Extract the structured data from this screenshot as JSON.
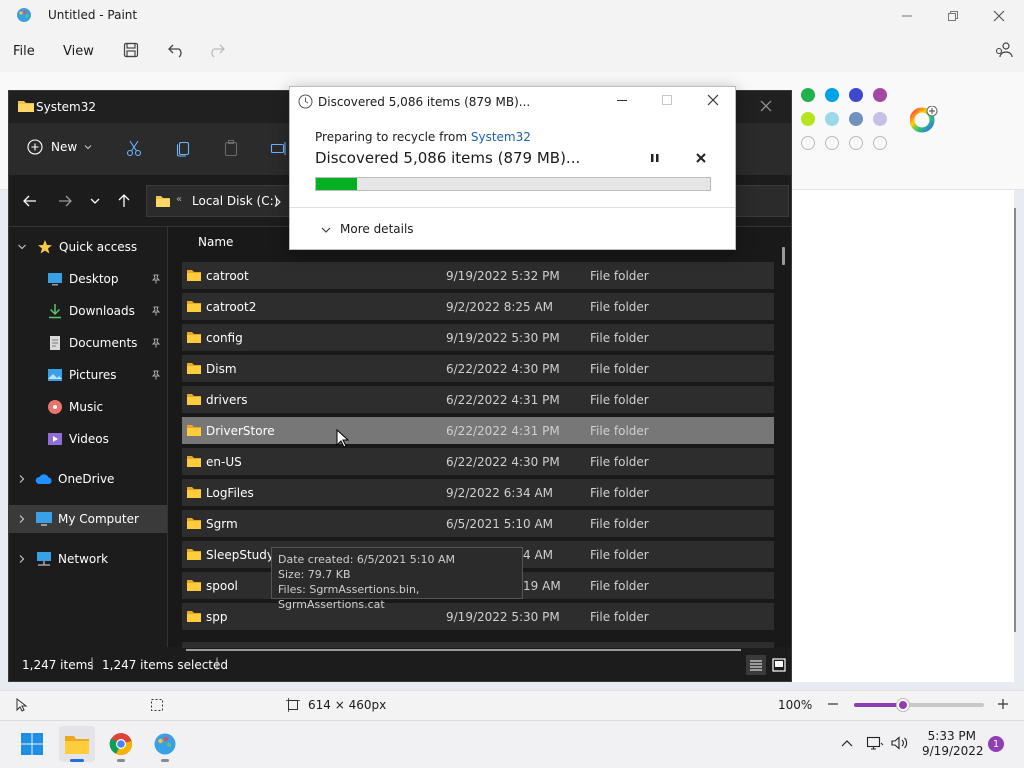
{
  "paint": {
    "title": "Untitled - Paint",
    "menu": [
      "File",
      "View"
    ],
    "status": {
      "canvas_size": "614 × 460px",
      "zoom": "100%"
    },
    "zoom_fraction": 0.38,
    "palette": [
      "#22b14c",
      "#00a2e8",
      "#3f48cc",
      "#a349a4",
      "#b5e61d",
      "#99d9ea",
      "#7092be",
      "#c8bfe7"
    ]
  },
  "explorer": {
    "title": "System32",
    "toolbar": {
      "new_label": "New"
    },
    "breadcrumb": {
      "root": "Local Disk (C:)"
    },
    "column_name": "Name",
    "nav": [
      {
        "label": "Quick access",
        "icon": "star-icon"
      },
      {
        "label": "Desktop",
        "icon": "desktop-icon"
      },
      {
        "label": "Downloads",
        "icon": "download-icon"
      },
      {
        "label": "Documents",
        "icon": "document-icon"
      },
      {
        "label": "Pictures",
        "icon": "picture-icon"
      },
      {
        "label": "Music",
        "icon": "music-icon"
      },
      {
        "label": "Videos",
        "icon": "video-icon"
      },
      {
        "label": "OneDrive",
        "icon": "cloud-icon"
      },
      {
        "label": "My Computer",
        "icon": "computer-icon"
      },
      {
        "label": "Network",
        "icon": "network-icon"
      }
    ],
    "files": [
      {
        "name": "catroot",
        "date": "9/19/2022 5:32 PM",
        "type": "File folder"
      },
      {
        "name": "catroot2",
        "date": "9/2/2022 8:25 AM",
        "type": "File folder"
      },
      {
        "name": "config",
        "date": "9/19/2022 5:30 PM",
        "type": "File folder"
      },
      {
        "name": "Dism",
        "date": "6/22/2022 4:30 PM",
        "type": "File folder"
      },
      {
        "name": "drivers",
        "date": "6/22/2022 4:31 PM",
        "type": "File folder"
      },
      {
        "name": "DriverStore",
        "date": "6/22/2022 4:31 PM",
        "type": "File folder"
      },
      {
        "name": "en-US",
        "date": "6/22/2022 4:30 PM",
        "type": "File folder"
      },
      {
        "name": "LogFiles",
        "date": "9/2/2022 6:34 AM",
        "type": "File folder"
      },
      {
        "name": "Sgrm",
        "date": "6/5/2021 5:10 AM",
        "type": "File folder"
      },
      {
        "name": "SleepStudy",
        "date": "9/2/2022 8:24 AM",
        "type": "File folder"
      },
      {
        "name": "spool",
        "date": "2/13/2022 1:19 AM",
        "type": "File folder"
      },
      {
        "name": "spp",
        "date": "9/19/2022 5:30 PM",
        "type": "File folder"
      }
    ],
    "status": {
      "item_count": "1,247 items",
      "selected_count": "1,247 items selected"
    },
    "tooltip": [
      "Date created: 6/5/2021 5:10 AM",
      "Size: 79.7 KB",
      "Files: SgrmAssertions.bin, SgrmAssertions.cat"
    ]
  },
  "dialog": {
    "title": "Discovered 5,086 items (879 MB)...",
    "subtitle_prefix": "Preparing to recycle from",
    "subtitle_link": "System32",
    "main": "Discovered 5,086 items (879 MB)...",
    "progress_fraction": 0.105,
    "progress_color": "#06b025",
    "more_details": "More details"
  },
  "taskbar": {
    "time": "5:33 PM",
    "date": "9/19/2022",
    "notification_count": "1",
    "apps": [
      "windows-start-icon",
      "file-explorer-icon",
      "chrome-icon",
      "paint-icon"
    ]
  }
}
